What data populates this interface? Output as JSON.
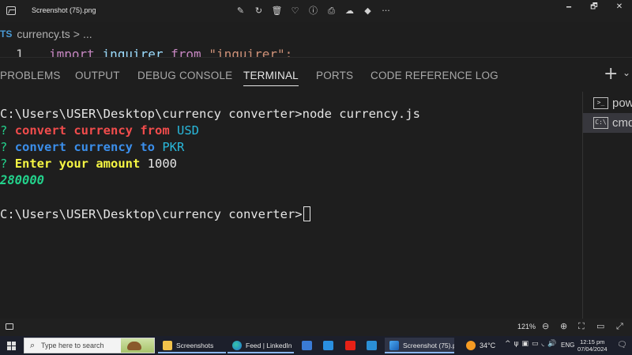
{
  "window": {
    "title": "Screenshot (75).png",
    "controls": {
      "minimize": "🗕",
      "restore": "🗗",
      "close": "✕"
    },
    "tool_glyphs": [
      "✎",
      "↻",
      "🗑",
      "♡",
      "ⓘ",
      "⎙",
      "☁",
      "◆",
      "···"
    ]
  },
  "editor": {
    "file_badge": "TS",
    "file_name": "currency.ts",
    "breadcrumb_sep": ">",
    "breadcrumb_more": "...",
    "line_number": "1",
    "code": {
      "kw_import": "import",
      "ident": "inquirer",
      "kw_from": "from",
      "module": "\"inquirer\";"
    }
  },
  "panel": {
    "tabs": [
      {
        "label": "PROBLEMS"
      },
      {
        "label": "OUTPUT"
      },
      {
        "label": "DEBUG CONSOLE"
      },
      {
        "label": "TERMINAL"
      },
      {
        "label": "PORTS"
      },
      {
        "label": "CODE REFERENCE LOG"
      }
    ],
    "active_tab": "TERMINAL",
    "plus_glyph": "+",
    "chevron_glyph": "⌄"
  },
  "terminal": {
    "prompt1": "C:\\Users\\USER\\Desktop\\currency converter>",
    "command": "node currency.js",
    "q_mark": "?",
    "q1_text": "convert currency from",
    "q1_answer": "USD",
    "q2_text": "convert currency to",
    "q2_answer": "PKR",
    "q3_text": "Enter your amount",
    "q3_answer": "1000",
    "result": "280000",
    "prompt2": "C:\\Users\\USER\\Desktop\\currency converter>"
  },
  "terminal_list": [
    {
      "icon_text": ">_",
      "label": "pow"
    },
    {
      "icon_text": "C:\\",
      "label": "cmd"
    }
  ],
  "viewer_bar": {
    "zoom": "121%",
    "glyphs": [
      "⊖",
      "⊕",
      "⛶",
      "▭",
      "⤢"
    ]
  },
  "taskbar": {
    "search_placeholder": "Type here to search",
    "search_glyph": "⌕",
    "apps": [
      {
        "label": "Screenshots"
      },
      {
        "label": "Feed | LinkedIn a..."
      },
      {
        "label": "Screenshot (75).p..."
      }
    ],
    "temperature": "34°C",
    "tray_glyphs": [
      "^",
      "ψ",
      "▣",
      "▭",
      "◟",
      "🔊"
    ],
    "language": "ENG",
    "time": "12:15 pm",
    "date": "07/04/2024",
    "notification_glyph": "🗨"
  },
  "colors": {
    "terminal_bg": "#1e1e1e",
    "prompt_q": "#23d18b",
    "q1": "#f14c4c",
    "q2": "#3b8eea",
    "q3": "#f5f543",
    "result": "#23d18b",
    "answer": "#29b8db",
    "taskbar": "#1c1f2b"
  }
}
